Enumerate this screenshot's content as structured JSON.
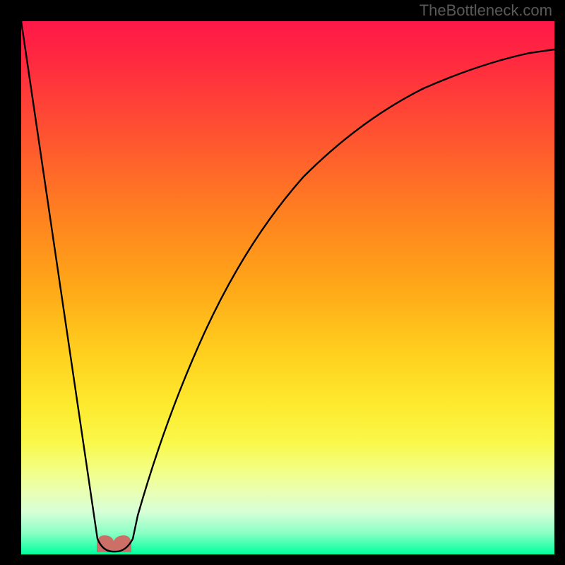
{
  "attribution": "TheBottleneck.com",
  "chart_data": {
    "type": "line",
    "title": "",
    "xlabel": "",
    "ylabel": "",
    "xlim": [
      0,
      100
    ],
    "ylim": [
      0,
      100
    ],
    "series": [
      {
        "name": "curve",
        "points": [
          {
            "x": 0,
            "y": 100
          },
          {
            "x": 14,
            "y": 3
          },
          {
            "x": 17.5,
            "y": 0.5
          },
          {
            "x": 21,
            "y": 3
          },
          {
            "x": 28,
            "y": 25
          },
          {
            "x": 36,
            "y": 47
          },
          {
            "x": 45,
            "y": 63
          },
          {
            "x": 55,
            "y": 74
          },
          {
            "x": 65,
            "y": 81.5
          },
          {
            "x": 75,
            "y": 86.5
          },
          {
            "x": 85,
            "y": 90
          },
          {
            "x": 95,
            "y": 92.5
          },
          {
            "x": 100,
            "y": 93.5
          }
        ]
      }
    ],
    "marker": {
      "name": "zone-of-interest",
      "x_range": [
        14.5,
        21
      ],
      "y": 1,
      "color": "#cc6f66"
    },
    "background_gradient": {
      "top": "#ff1848",
      "middle": "#ffd21e",
      "bottom": "#00ff9e"
    }
  }
}
